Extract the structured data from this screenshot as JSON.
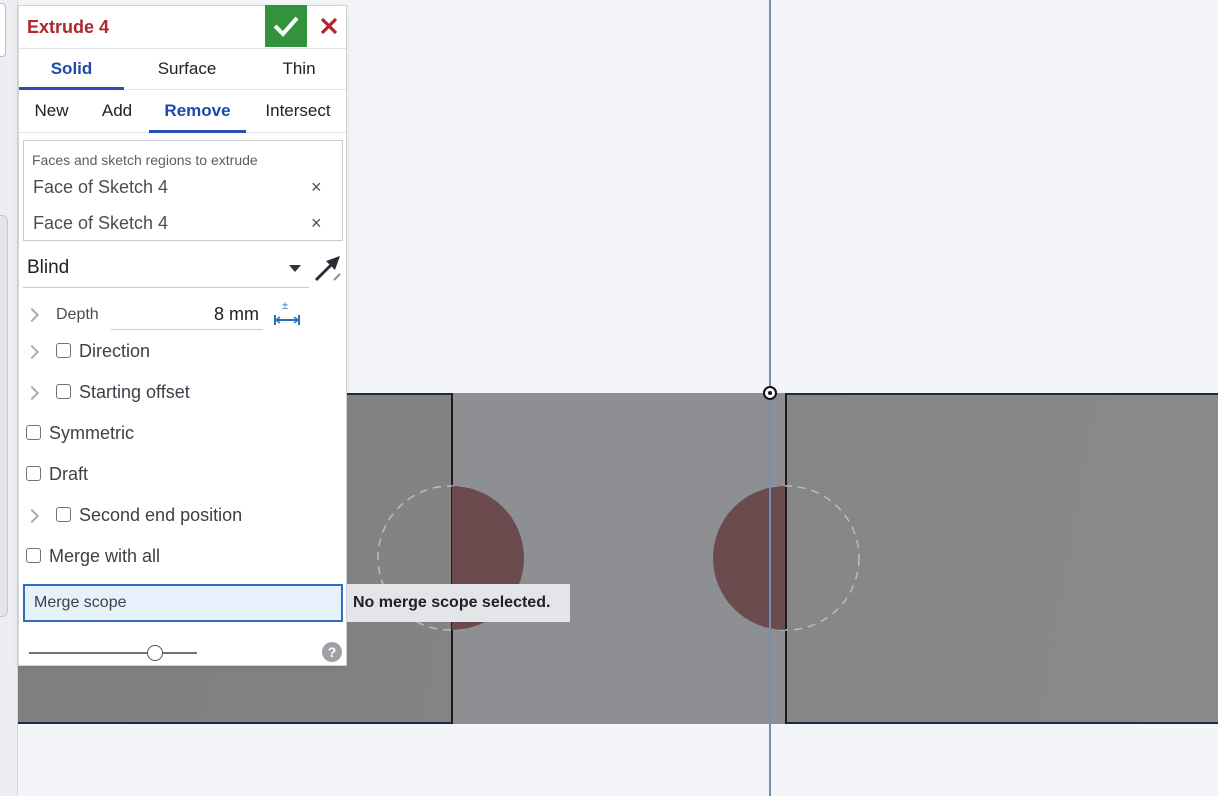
{
  "dialog": {
    "title": "Extrude 4",
    "ok_icon": "checkmark-icon",
    "cancel_icon": "close-icon",
    "tabs": [
      {
        "label": "Solid",
        "active": true
      },
      {
        "label": "Surface",
        "active": false
      },
      {
        "label": "Thin",
        "active": false
      }
    ],
    "operations": [
      {
        "label": "New",
        "active": false
      },
      {
        "label": "Add",
        "active": false
      },
      {
        "label": "Remove",
        "active": true
      },
      {
        "label": "Intersect",
        "active": false
      }
    ],
    "selection": {
      "label": "Faces and sketch regions to extrude",
      "items": [
        "Face of Sketch 4",
        "Face of Sketch 4"
      ],
      "remove_glyph": "×"
    },
    "end_type": "Blind",
    "depth": {
      "label": "Depth",
      "value": "8 mm"
    },
    "options": {
      "direction": "Direction",
      "starting_offset": "Starting offset",
      "symmetric": "Symmetric",
      "draft": "Draft",
      "second_end_position": "Second end position",
      "merge_with_all": "Merge with all"
    },
    "merge_scope": {
      "label": "Merge scope",
      "tooltip": "No merge scope selected."
    },
    "help_glyph": "?",
    "slider_level": 0.75
  },
  "colors": {
    "title": "#b1252d",
    "ok_button": "#35923c",
    "active_tab": "#1f4aa8",
    "selected_field": "#e6f1fb",
    "highlight_region": "#6b4b4e",
    "axis": "#6f8fb8"
  }
}
